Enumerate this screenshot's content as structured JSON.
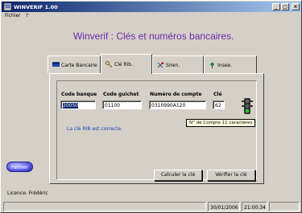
{
  "window": {
    "title": "WINVERIF 1.00",
    "minimize": "_",
    "maximize": "□",
    "close": "×"
  },
  "menu": [
    "Fichier",
    "?"
  ],
  "headline": "Winverif : Clés et numéros bancaires.",
  "tabs": [
    {
      "label": "Carte Bancaire",
      "active": false
    },
    {
      "label": "Clé Rib.",
      "active": true
    },
    {
      "label": "Siren.",
      "active": false
    },
    {
      "label": "Insee.",
      "active": false
    }
  ],
  "form": {
    "code_banque": {
      "label": "Code banque",
      "value": "20050"
    },
    "code_guichet": {
      "label": "Code guichet",
      "value": "01100"
    },
    "numero_compte": {
      "label": "Numéro de compte",
      "value": "0310990A120"
    },
    "cle": {
      "label": "Clé",
      "value": "62"
    }
  },
  "message": "La clé RIB est correcte.",
  "tooltip": "N° de Compte 11 caractères",
  "buttons": {
    "calculer": "Calculer la clé",
    "verifier": "Vérifier la clé",
    "fermer": "Fermer"
  },
  "licence": "Licence: Frédéric",
  "statusbar": {
    "date": "30/01/2006",
    "time": "21:00:34"
  },
  "colors": {
    "headline": "#6b2aa6",
    "message": "#1a3fb5",
    "light_green": "#22cc22"
  }
}
